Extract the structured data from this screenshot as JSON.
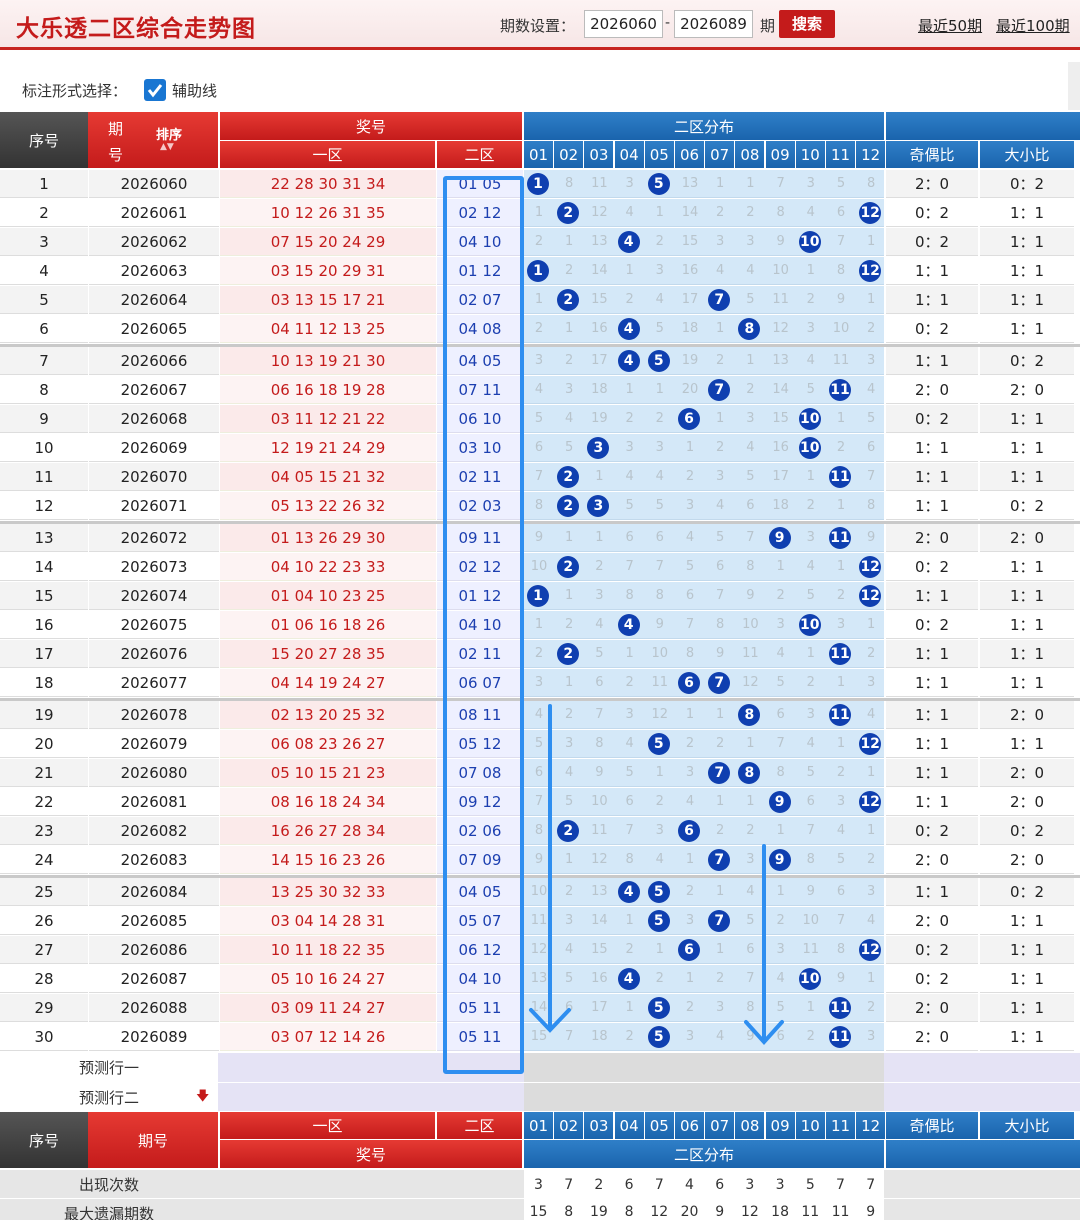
{
  "header": {
    "title": "大乐透二区综合走势图",
    "period_label": "期数设置：",
    "period_start": "2026060",
    "period_end": "2026089",
    "period_dash": "-",
    "period_unit": "期",
    "search_button": "搜索",
    "recent_50": "最近50期",
    "recent_100": "最近100期"
  },
  "options": {
    "label": "标注形式选择：",
    "aux_line": "辅助线",
    "aux_checked": true
  },
  "table_header": {
    "seq": "序号",
    "period_line1": "期",
    "period_line2": "号",
    "sort": "排序",
    "prize": "奖号",
    "zone1": "一区",
    "zone2": "二区",
    "zone2_dist": "二区分布",
    "numbers": [
      "01",
      "02",
      "03",
      "04",
      "05",
      "06",
      "07",
      "08",
      "09",
      "10",
      "11",
      "12"
    ],
    "odd_even": "奇偶比",
    "big_small": "大小比"
  },
  "rows": [
    {
      "seq": "1",
      "period": "2026060",
      "zone1": "22 28 30 31 34",
      "zone2": "01 05",
      "odd_even": "2：0",
      "big_small": "0：2",
      "dist": [
        "B",
        "8",
        "11",
        "3",
        "B",
        "13",
        "1",
        "1",
        "7",
        "3",
        "5",
        "8"
      ]
    },
    {
      "seq": "2",
      "period": "2026061",
      "zone1": "10 12 26 31 35",
      "zone2": "02 12",
      "odd_even": "0：2",
      "big_small": "1：1",
      "dist": [
        "1",
        "B",
        "12",
        "4",
        "1",
        "14",
        "2",
        "2",
        "8",
        "4",
        "6",
        "B"
      ]
    },
    {
      "seq": "3",
      "period": "2026062",
      "zone1": "07 15 20 24 29",
      "zone2": "04 10",
      "odd_even": "0：2",
      "big_small": "1：1",
      "dist": [
        "2",
        "1",
        "13",
        "B",
        "2",
        "15",
        "3",
        "3",
        "9",
        "B",
        "7",
        "1"
      ]
    },
    {
      "seq": "4",
      "period": "2026063",
      "zone1": "03 15 20 29 31",
      "zone2": "01 12",
      "odd_even": "1：1",
      "big_small": "1：1",
      "dist": [
        "B",
        "2",
        "14",
        "1",
        "3",
        "16",
        "4",
        "4",
        "10",
        "1",
        "8",
        "B"
      ]
    },
    {
      "seq": "5",
      "period": "2026064",
      "zone1": "03 13 15 17 21",
      "zone2": "02 07",
      "odd_even": "1：1",
      "big_small": "1：1",
      "dist": [
        "1",
        "B",
        "15",
        "2",
        "4",
        "17",
        "B",
        "5",
        "11",
        "2",
        "9",
        "1"
      ]
    },
    {
      "seq": "6",
      "period": "2026065",
      "zone1": "04 11 12 13 25",
      "zone2": "04 08",
      "odd_even": "0：2",
      "big_small": "1：1",
      "dist": [
        "2",
        "1",
        "16",
        "B",
        "5",
        "18",
        "1",
        "B",
        "12",
        "3",
        "10",
        "2"
      ]
    },
    {
      "seq": "7",
      "period": "2026066",
      "zone1": "10 13 19 21 30",
      "zone2": "04 05",
      "odd_even": "1：1",
      "big_small": "0：2",
      "dist": [
        "3",
        "2",
        "17",
        "B",
        "B",
        "19",
        "2",
        "1",
        "13",
        "4",
        "11",
        "3"
      ]
    },
    {
      "seq": "8",
      "period": "2026067",
      "zone1": "06 16 18 19 28",
      "zone2": "07 11",
      "odd_even": "2：0",
      "big_small": "2：0",
      "dist": [
        "4",
        "3",
        "18",
        "1",
        "1",
        "20",
        "B",
        "2",
        "14",
        "5",
        "B",
        "4"
      ]
    },
    {
      "seq": "9",
      "period": "2026068",
      "zone1": "03 11 12 21 22",
      "zone2": "06 10",
      "odd_even": "0：2",
      "big_small": "1：1",
      "dist": [
        "5",
        "4",
        "19",
        "2",
        "2",
        "B",
        "1",
        "3",
        "15",
        "B",
        "1",
        "5"
      ]
    },
    {
      "seq": "10",
      "period": "2026069",
      "zone1": "12 19 21 24 29",
      "zone2": "03 10",
      "odd_even": "1：1",
      "big_small": "1：1",
      "dist": [
        "6",
        "5",
        "B",
        "3",
        "3",
        "1",
        "2",
        "4",
        "16",
        "B",
        "2",
        "6"
      ]
    },
    {
      "seq": "11",
      "period": "2026070",
      "zone1": "04 05 15 21 32",
      "zone2": "02 11",
      "odd_even": "1：1",
      "big_small": "1：1",
      "dist": [
        "7",
        "B",
        "1",
        "4",
        "4",
        "2",
        "3",
        "5",
        "17",
        "1",
        "B",
        "7"
      ]
    },
    {
      "seq": "12",
      "period": "2026071",
      "zone1": "05 13 22 26 32",
      "zone2": "02 03",
      "odd_even": "1：1",
      "big_small": "0：2",
      "dist": [
        "8",
        "B",
        "B",
        "5",
        "5",
        "3",
        "4",
        "6",
        "18",
        "2",
        "1",
        "8"
      ]
    },
    {
      "seq": "13",
      "period": "2026072",
      "zone1": "01 13 26 29 30",
      "zone2": "09 11",
      "odd_even": "2：0",
      "big_small": "2：0",
      "dist": [
        "9",
        "1",
        "1",
        "6",
        "6",
        "4",
        "5",
        "7",
        "B",
        "3",
        "B",
        "9"
      ]
    },
    {
      "seq": "14",
      "period": "2026073",
      "zone1": "04 10 22 23 33",
      "zone2": "02 12",
      "odd_even": "0：2",
      "big_small": "1：1",
      "dist": [
        "10",
        "B",
        "2",
        "7",
        "7",
        "5",
        "6",
        "8",
        "1",
        "4",
        "1",
        "B"
      ]
    },
    {
      "seq": "15",
      "period": "2026074",
      "zone1": "01 04 10 23 25",
      "zone2": "01 12",
      "odd_even": "1：1",
      "big_small": "1：1",
      "dist": [
        "B",
        "1",
        "3",
        "8",
        "8",
        "6",
        "7",
        "9",
        "2",
        "5",
        "2",
        "B"
      ]
    },
    {
      "seq": "16",
      "period": "2026075",
      "zone1": "01 06 16 18 26",
      "zone2": "04 10",
      "odd_even": "0：2",
      "big_small": "1：1",
      "dist": [
        "1",
        "2",
        "4",
        "B",
        "9",
        "7",
        "8",
        "10",
        "3",
        "B",
        "3",
        "1"
      ]
    },
    {
      "seq": "17",
      "period": "2026076",
      "zone1": "15 20 27 28 35",
      "zone2": "02 11",
      "odd_even": "1：1",
      "big_small": "1：1",
      "dist": [
        "2",
        "B",
        "5",
        "1",
        "10",
        "8",
        "9",
        "11",
        "4",
        "1",
        "B",
        "2"
      ]
    },
    {
      "seq": "18",
      "period": "2026077",
      "zone1": "04 14 19 24 27",
      "zone2": "06 07",
      "odd_even": "1：1",
      "big_small": "1：1",
      "dist": [
        "3",
        "1",
        "6",
        "2",
        "11",
        "B",
        "B",
        "12",
        "5",
        "2",
        "1",
        "3"
      ]
    },
    {
      "seq": "19",
      "period": "2026078",
      "zone1": "02 13 20 25 32",
      "zone2": "08 11",
      "odd_even": "1：1",
      "big_small": "2：0",
      "dist": [
        "4",
        "2",
        "7",
        "3",
        "12",
        "1",
        "1",
        "B",
        "6",
        "3",
        "B",
        "4"
      ]
    },
    {
      "seq": "20",
      "period": "2026079",
      "zone1": "06 08 23 26 27",
      "zone2": "05 12",
      "odd_even": "1：1",
      "big_small": "1：1",
      "dist": [
        "5",
        "3",
        "8",
        "4",
        "B",
        "2",
        "2",
        "1",
        "7",
        "4",
        "1",
        "B"
      ]
    },
    {
      "seq": "21",
      "period": "2026080",
      "zone1": "05 10 15 21 23",
      "zone2": "07 08",
      "odd_even": "1：1",
      "big_small": "2：0",
      "dist": [
        "6",
        "4",
        "9",
        "5",
        "1",
        "3",
        "B",
        "B",
        "8",
        "5",
        "2",
        "1"
      ]
    },
    {
      "seq": "22",
      "period": "2026081",
      "zone1": "08 16 18 24 34",
      "zone2": "09 12",
      "odd_even": "1：1",
      "big_small": "2：0",
      "dist": [
        "7",
        "5",
        "10",
        "6",
        "2",
        "4",
        "1",
        "1",
        "B",
        "6",
        "3",
        "B"
      ]
    },
    {
      "seq": "23",
      "period": "2026082",
      "zone1": "16 26 27 28 34",
      "zone2": "02 06",
      "odd_even": "0：2",
      "big_small": "0：2",
      "dist": [
        "8",
        "B",
        "11",
        "7",
        "3",
        "B",
        "2",
        "2",
        "1",
        "7",
        "4",
        "1"
      ]
    },
    {
      "seq": "24",
      "period": "2026083",
      "zone1": "14 15 16 23 26",
      "zone2": "07 09",
      "odd_even": "2：0",
      "big_small": "2：0",
      "dist": [
        "9",
        "1",
        "12",
        "8",
        "4",
        "1",
        "B",
        "3",
        "B",
        "8",
        "5",
        "2"
      ]
    },
    {
      "seq": "25",
      "period": "2026084",
      "zone1": "13 25 30 32 33",
      "zone2": "04 05",
      "odd_even": "1：1",
      "big_small": "0：2",
      "dist": [
        "10",
        "2",
        "13",
        "B",
        "B",
        "2",
        "1",
        "4",
        "1",
        "9",
        "6",
        "3"
      ]
    },
    {
      "seq": "26",
      "period": "2026085",
      "zone1": "03 04 14 28 31",
      "zone2": "05 07",
      "odd_even": "2：0",
      "big_small": "1：1",
      "dist": [
        "11",
        "3",
        "14",
        "1",
        "B",
        "3",
        "B",
        "5",
        "2",
        "10",
        "7",
        "4"
      ]
    },
    {
      "seq": "27",
      "period": "2026086",
      "zone1": "10 11 18 22 35",
      "zone2": "06 12",
      "odd_even": "0：2",
      "big_small": "1：1",
      "dist": [
        "12",
        "4",
        "15",
        "2",
        "1",
        "B",
        "1",
        "6",
        "3",
        "11",
        "8",
        "B"
      ]
    },
    {
      "seq": "28",
      "period": "2026087",
      "zone1": "05 10 16 24 27",
      "zone2": "04 10",
      "odd_even": "0：2",
      "big_small": "1：1",
      "dist": [
        "13",
        "5",
        "16",
        "B",
        "2",
        "1",
        "2",
        "7",
        "4",
        "B",
        "9",
        "1"
      ]
    },
    {
      "seq": "29",
      "period": "2026088",
      "zone1": "03 09 11 24 27",
      "zone2": "05 11",
      "odd_even": "2：0",
      "big_small": "1：1",
      "dist": [
        "14",
        "6",
        "17",
        "1",
        "B",
        "2",
        "3",
        "8",
        "5",
        "1",
        "B",
        "2"
      ]
    },
    {
      "seq": "30",
      "period": "2026089",
      "zone1": "03 07 12 14 26",
      "zone2": "05 11",
      "odd_even": "2：0",
      "big_small": "1：1",
      "dist": [
        "15",
        "7",
        "18",
        "2",
        "B",
        "3",
        "4",
        "9",
        "6",
        "2",
        "B",
        "3"
      ]
    }
  ],
  "predict": {
    "row1": "预测行一",
    "row2": "预测行二"
  },
  "footer_header": {
    "seq": "序号",
    "period": "期号",
    "zone1": "一区",
    "zone2": "二区",
    "prize": "奖号",
    "zone2_dist": "二区分布",
    "odd_even": "奇偶比",
    "big_small": "大小比"
  },
  "stats": {
    "appear_label": "出现次数",
    "appear": [
      "3",
      "7",
      "2",
      "6",
      "7",
      "4",
      "6",
      "3",
      "3",
      "5",
      "7",
      "7"
    ],
    "maxmiss_label": "最大遗漏期数",
    "maxmiss": [
      "15",
      "8",
      "19",
      "8",
      "12",
      "20",
      "9",
      "12",
      "18",
      "11",
      "11",
      "9"
    ]
  },
  "colors": {
    "accent_red": "#c41b1b",
    "accent_blue": "#1a64ad",
    "ball": "#0f3fb0",
    "annotation": "#2e8ef0"
  }
}
